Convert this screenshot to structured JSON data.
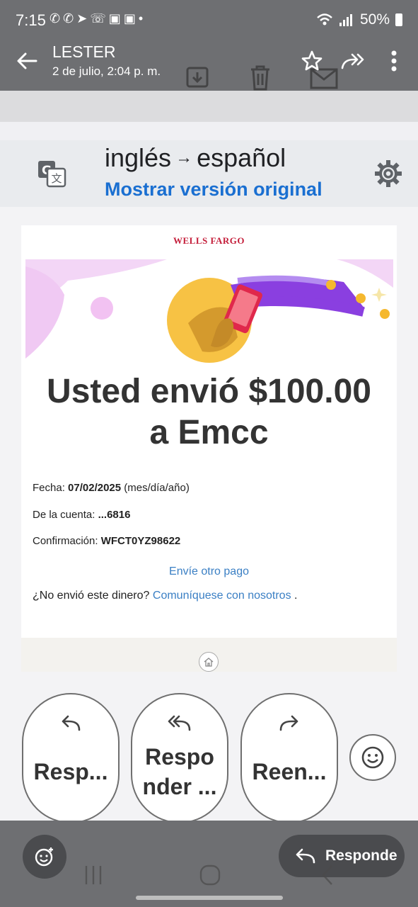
{
  "status_bar": {
    "time": "7:15",
    "battery": "50%",
    "icons": [
      "whatsapp-icon",
      "whatsapp-icon",
      "telegram-icon",
      "phone-icon",
      "app-icon",
      "app-icon",
      "dot-icon"
    ]
  },
  "header": {
    "sender": "LESTER",
    "date": "2 de julio, 2:04 p. m.",
    "actions": [
      "star-icon",
      "forward-all-icon",
      "more-vert-icon"
    ]
  },
  "translate": {
    "from": "inglés",
    "arrow": "→",
    "to": "español",
    "show_original": "Mostrar versión original"
  },
  "email": {
    "brand": "WELLS FARGO",
    "headline_line1": "Usted envió $100.00",
    "headline_line2": "a Emcc",
    "date_label": "Fecha:",
    "date_value": "07/02/2025",
    "date_format": "(mes/día/año)",
    "account_label": "De la cuenta:",
    "account_value": "...6816",
    "confirmation_label": "Confirmación:",
    "confirmation_value": "WFCT0YZ98622",
    "send_another": "Envíe otro pago",
    "not_sent_question": "¿No envió este dinero?",
    "contact_link": "Comuníquese con nosotros",
    "contact_suffix": "."
  },
  "smart_replies": [
    {
      "icon": "reply-icon",
      "label": "Resp..."
    },
    {
      "icon": "reply-all-icon",
      "label_line1": "Respo",
      "label_line2": "nder ..."
    },
    {
      "icon": "forward-icon",
      "label": "Reen..."
    }
  ],
  "bottom_bar": {
    "reply_label": "Responde"
  },
  "colors": {
    "app_bar": "#6e6f72",
    "link_blue": "#1a6fd1",
    "brand_red": "#c41e3a",
    "purple": "#8a3fe0",
    "gold": "#f5b82e"
  }
}
